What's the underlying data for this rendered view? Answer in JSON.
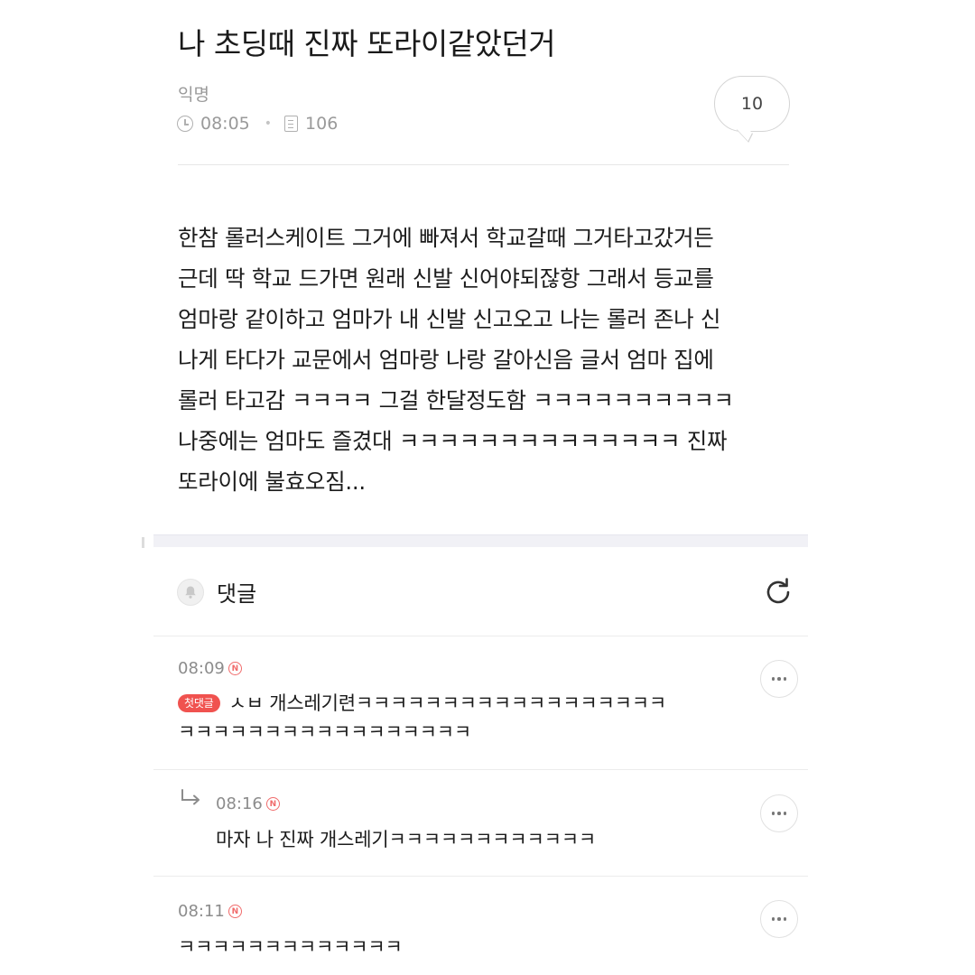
{
  "post": {
    "title": "나 초딩때 진짜 또라이같았던거",
    "author": "익명",
    "time": "08:05",
    "views": "106",
    "comment_count": "10",
    "body_lines": [
      "한참 롤러스케이트 그거에 빠져서 학교갈때 그거타고갔거든",
      "근데 딱 학교 드가면 원래 신발 신어야되잖항 그래서 등교를",
      "엄마랑 같이하고 엄마가 내 신발 신고오고 나는 롤러 존나 신",
      "나게 타다가 교문에서 엄마랑 나랑 갈아신음 글서 엄마 집에",
      "롤러 타고감 ㅋㅋㅋㅋ 그걸 한달정도함 ㅋㅋㅋㅋㅋㅋㅋㅋㅋㅋ",
      "나중에는 엄마도 즐겼대 ㅋㅋㅋㅋㅋㅋㅋㅋㅋㅋㅋㅋㅋㅋ 진짜",
      "또라이에 불효오짐..."
    ]
  },
  "comments_section": {
    "label": "댓글",
    "new_badge": "N",
    "first_comment_badge": "첫댓글",
    "items": [
      {
        "time": "08:09",
        "lines": [
          "ㅅㅂ 개스레기련ㅋㅋㅋㅋㅋㅋㅋㅋㅋㅋㅋㅋㅋㅋㅋㅋㅋㅋ",
          "ㅋㅋㅋㅋㅋㅋㅋㅋㅋㅋㅋㅋㅋㅋㅋㅋㅋ"
        ]
      },
      {
        "time": "08:16",
        "lines": [
          "마자 나 진짜 개스레기ㅋㅋㅋㅋㅋㅋㅋㅋㅋㅋㅋㅋ"
        ]
      },
      {
        "time": "08:11",
        "lines": [
          "ㅋㅋㅋㅋㅋㅋㅋㅋㅋㅋㅋㅋㅋ"
        ]
      }
    ]
  },
  "icons": {
    "clock": "clock-icon",
    "views": "document-icon",
    "comments": "speech-bubble-icon",
    "bell": "bell-icon",
    "refresh": "refresh-icon",
    "more": "more-horizontal-icon",
    "reply": "reply-arrow-icon"
  },
  "colors": {
    "accent_red": "#f0524f",
    "meta_gray": "#9a9a9a",
    "text": "#1c1c1c"
  }
}
